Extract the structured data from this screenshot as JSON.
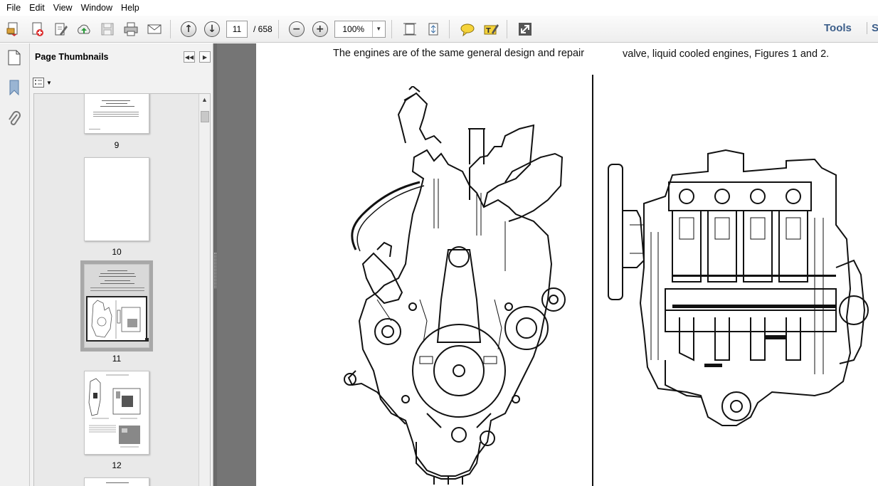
{
  "menu": [
    "File",
    "Edit",
    "View",
    "Window",
    "Help"
  ],
  "toolbar": {
    "current_page": "11",
    "total_pages": "/ 658",
    "zoom": "100%",
    "tools_label": "Tools",
    "sign_label": "Si",
    "icons": [
      "create-pdf-icon",
      "add-file-icon",
      "edit-icon",
      "upload-icon",
      "save-icon",
      "print-icon",
      "email-icon",
      "previous-page-icon",
      "next-page-icon",
      "zoom-out-icon",
      "zoom-in-icon",
      "fit-page-icon",
      "fit-width-icon",
      "comment-icon",
      "highlight-icon",
      "fullscreen-icon"
    ]
  },
  "sidebar": {
    "title": "Page Thumbnails",
    "thumbnails": [
      {
        "label": "9",
        "selected": false
      },
      {
        "label": "10",
        "selected": false
      },
      {
        "label": "11",
        "selected": true
      },
      {
        "label": "12",
        "selected": false
      }
    ]
  },
  "document": {
    "left_column_text": "The engines are of the same general design and repair",
    "right_column_text": "valve, liquid cooled engines, Figures 1 and 2."
  }
}
